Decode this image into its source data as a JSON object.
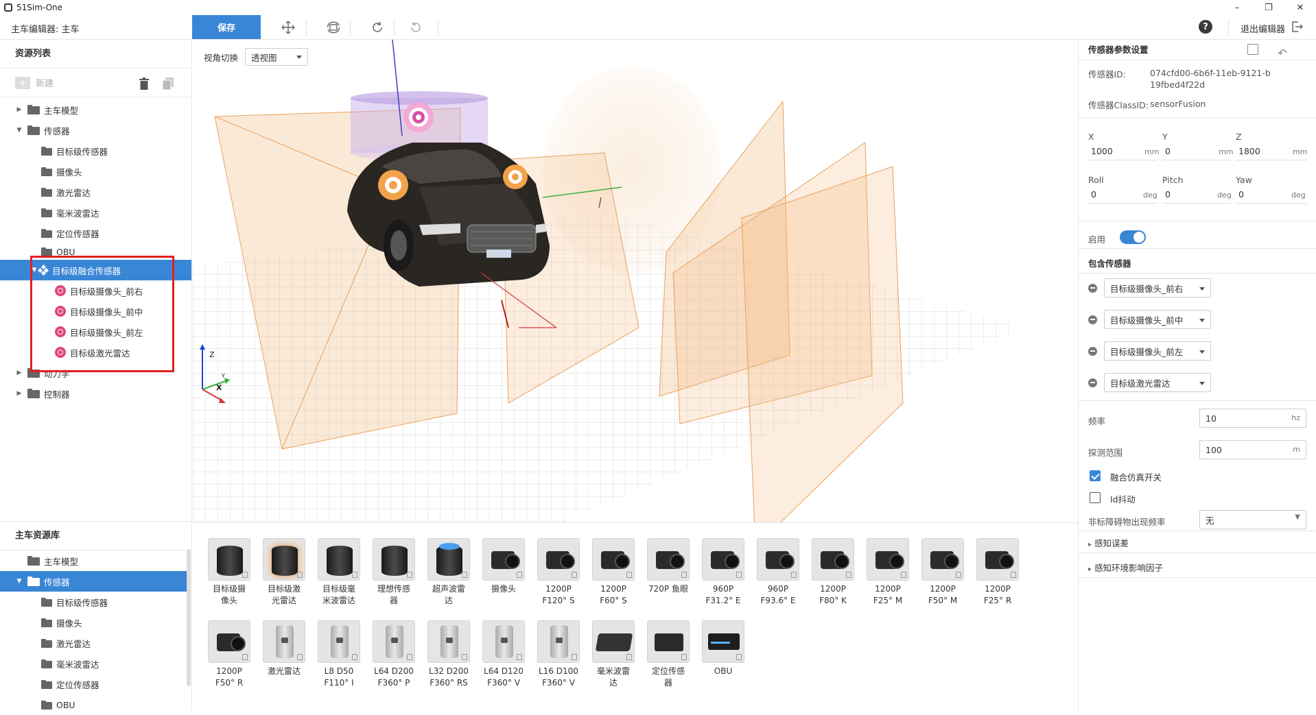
{
  "app": {
    "title": "51Sim-One"
  },
  "window": {
    "minimize": "–",
    "maximize": "❐",
    "close": "✕"
  },
  "toolbar": {
    "editor_title": "主车编辑器: 主车",
    "save_label": "保存",
    "exit_label": "退出编辑器",
    "help": "?"
  },
  "resource_list": {
    "title": "资源列表",
    "new_label": "新建",
    "tree": [
      {
        "label": "主车模型",
        "level": 0,
        "expanded": false
      },
      {
        "label": "传感器",
        "level": 0,
        "expanded": true
      },
      {
        "label": "目标级传感器",
        "level": 1
      },
      {
        "label": "摄像头",
        "level": 1
      },
      {
        "label": "激光雷达",
        "level": 1
      },
      {
        "label": "毫米波雷达",
        "level": 1
      },
      {
        "label": "定位传感器",
        "level": 1
      },
      {
        "label": "OBU",
        "level": 1
      },
      {
        "label": "目标级融合传感器",
        "level": 1,
        "selected": true
      },
      {
        "label": "目标级摄像头_前右",
        "level": 2
      },
      {
        "label": "目标级摄像头_前中",
        "level": 2
      },
      {
        "label": "目标级摄像头_前左",
        "level": 2
      },
      {
        "label": "目标级激光雷达",
        "level": 2
      },
      {
        "label": "动力学",
        "level": 0,
        "expanded": false
      },
      {
        "label": "控制器",
        "level": 0,
        "expanded": false
      }
    ]
  },
  "main_library": {
    "title": "主车资源库",
    "tree": [
      {
        "label": "主车模型",
        "level": 0
      },
      {
        "label": "传感器",
        "level": 0,
        "selected": true
      },
      {
        "label": "目标级传感器",
        "level": 1
      },
      {
        "label": "摄像头",
        "level": 1
      },
      {
        "label": "激光雷达",
        "level": 1
      },
      {
        "label": "毫米波雷达",
        "level": 1
      },
      {
        "label": "定位传感器",
        "level": 1
      },
      {
        "label": "OBU",
        "level": 1
      }
    ]
  },
  "viewport": {
    "view_switch_label": "视角切换",
    "view_mode": "透视图",
    "axis_z": "Z",
    "axis_y": "Y",
    "axis_x": "X"
  },
  "assets": [
    {
      "line1": "目标级摄",
      "line2": "像头",
      "icon": "cylinder-sensor"
    },
    {
      "line1": "目标级激",
      "line2": "光雷达",
      "icon": "cylinder-sensor-orange"
    },
    {
      "line1": "目标级毫",
      "line2": "米波雷达",
      "icon": "cylinder-sensor"
    },
    {
      "line1": "理想传感",
      "line2": "器",
      "icon": "cylinder-sensor"
    },
    {
      "line1": "超声波雷",
      "line2": "达",
      "icon": "ultrasonic-sensor"
    },
    {
      "line1": "摄像头",
      "line2": "",
      "icon": "camera"
    },
    {
      "line1": "1200P",
      "line2": "F120° S",
      "icon": "camera"
    },
    {
      "line1": "1200P",
      "line2": "F60° S",
      "icon": "camera"
    },
    {
      "line1": "720P 鱼眼",
      "line2": "",
      "icon": "camera"
    },
    {
      "line1": "960P",
      "line2": "F31.2° E",
      "icon": "camera"
    },
    {
      "line1": "960P",
      "line2": "F93.6° E",
      "icon": "camera"
    },
    {
      "line1": "1200P",
      "line2": "F80° K",
      "icon": "camera"
    },
    {
      "line1": "1200P",
      "line2": "F25° M",
      "icon": "camera"
    },
    {
      "line1": "1200P",
      "line2": "F50° M",
      "icon": "camera"
    },
    {
      "line1": "1200P",
      "line2": "F25° R",
      "icon": "camera"
    },
    {
      "line1": "1200P",
      "line2": "F50° R",
      "icon": "camera"
    },
    {
      "line1": "激光雷达",
      "line2": "",
      "icon": "lidar"
    },
    {
      "line1": "L8 D50",
      "line2": "F110° I",
      "icon": "lidar"
    },
    {
      "line1": "L64 D200",
      "line2": "F360° P",
      "icon": "lidar"
    },
    {
      "line1": "L32 D200",
      "line2": "F360° RS",
      "icon": "lidar"
    },
    {
      "line1": "L64 D120",
      "line2": "F360° V",
      "icon": "lidar"
    },
    {
      "line1": "L16 D100",
      "line2": "F360° V",
      "icon": "lidar"
    },
    {
      "line1": "毫米波雷",
      "line2": "达",
      "icon": "radar"
    },
    {
      "line1": "定位传感",
      "line2": "器",
      "icon": "gps"
    },
    {
      "line1": "OBU",
      "line2": "",
      "icon": "obu"
    }
  ],
  "sensor_params": {
    "title": "传感器参数设置",
    "sensor_id_label": "传感器ID:",
    "sensor_id_value": "074cfd00-6b6f-11eb-9121-b19fbed4f22d",
    "class_id_label": "传感器ClassID:",
    "class_id_value": "sensorFusion",
    "x_label": "X",
    "x_value": "1000",
    "x_unit": "mm",
    "y_label": "Y",
    "y_value": "0",
    "y_unit": "mm",
    "z_label": "Z",
    "z_value": "1800",
    "z_unit": "mm",
    "roll_label": "Roll",
    "roll_value": "0",
    "roll_unit": "deg",
    "pitch_label": "Pitch",
    "pitch_value": "0",
    "pitch_unit": "deg",
    "yaw_label": "Yaw",
    "yaw_value": "0",
    "yaw_unit": "deg",
    "enable_label": "启用",
    "enabled": true,
    "included_label": "包含传感器",
    "included": [
      "目标级摄像头_前右",
      "目标级摄像头_前中",
      "目标级摄像头_前左",
      "目标级激光雷达"
    ],
    "freq_label": "频率",
    "freq_value": "10",
    "freq_unit": "hz",
    "range_label": "探测范围",
    "range_value": "100",
    "range_unit": "m",
    "fusion_switch_label": "融合仿真开关",
    "fusion_switch": true,
    "id_jitter_label": "Id抖动",
    "id_jitter": false,
    "non_std_label": "非标障碍物出现频率",
    "non_std_value": "无",
    "perception_error_label": "感知误差",
    "env_factor_label": "感知环境影响因子"
  },
  "colors": {
    "accent": "#3a86d6",
    "highlight_box": "#e02020",
    "sensor_dot": "#e0457b",
    "frustum": "#f3b77a"
  }
}
